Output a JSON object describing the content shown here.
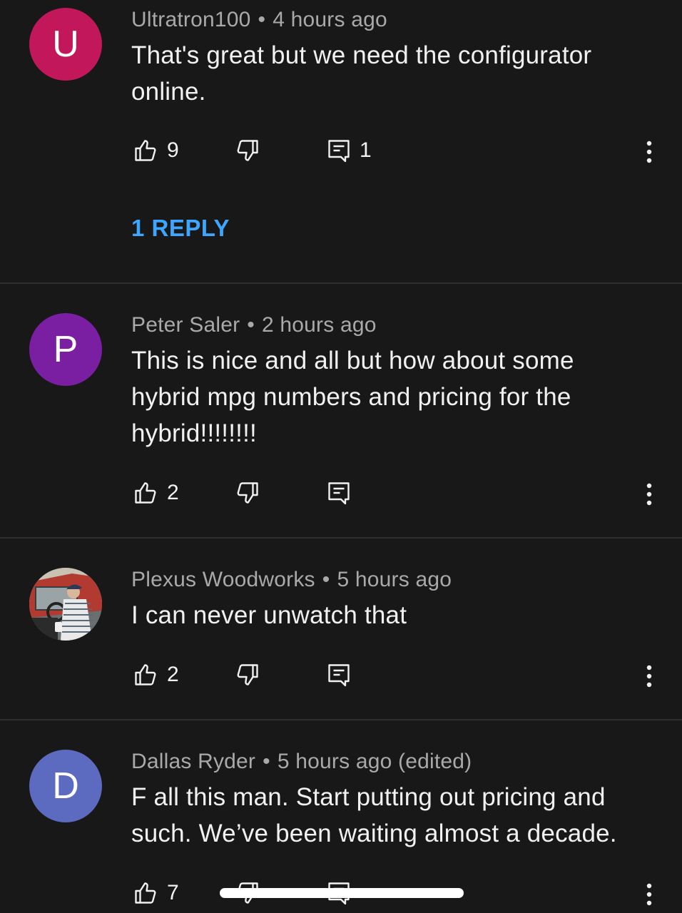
{
  "comments": [
    {
      "author": "Ultratron100",
      "separator": "•",
      "time": "4 hours ago",
      "avatar_letter": "U",
      "avatar_color": "#c2185b",
      "text": "That's great but we need the configurator online.",
      "likes": "9",
      "replies_count": "1",
      "reply_link": "1 REPLY"
    },
    {
      "author": "Peter Saler",
      "separator": "•",
      "time": "2 hours ago",
      "avatar_letter": "P",
      "avatar_color": "#7b1fa2",
      "text": "This is nice and all but how about some hybrid mpg numbers and pricing for the hybrid!!!!!!!!",
      "likes": "2"
    },
    {
      "author": "Plexus Woodworks",
      "separator": "•",
      "time": "5 hours ago",
      "avatar_letter": "",
      "avatar_color": "#5a5a5a",
      "text": "I can never unwatch that",
      "likes": "2"
    },
    {
      "author": "Dallas Ryder",
      "separator": "•",
      "time": "5 hours ago (edited)",
      "avatar_letter": "D",
      "avatar_color": "#5c6bc0",
      "text": "F all this man. Start putting out pricing and such. We’ve been waiting almost a decade.",
      "likes": "7"
    }
  ],
  "icons": {
    "like": "thumbs-up-outline",
    "dislike": "thumbs-down-outline",
    "reply": "comment-outline",
    "more": "vertical-ellipsis"
  },
  "colors": {
    "background": "#181818",
    "link": "#3ea6ff",
    "meta_text": "#a9a9a9",
    "body_text": "#f1f1f1"
  }
}
